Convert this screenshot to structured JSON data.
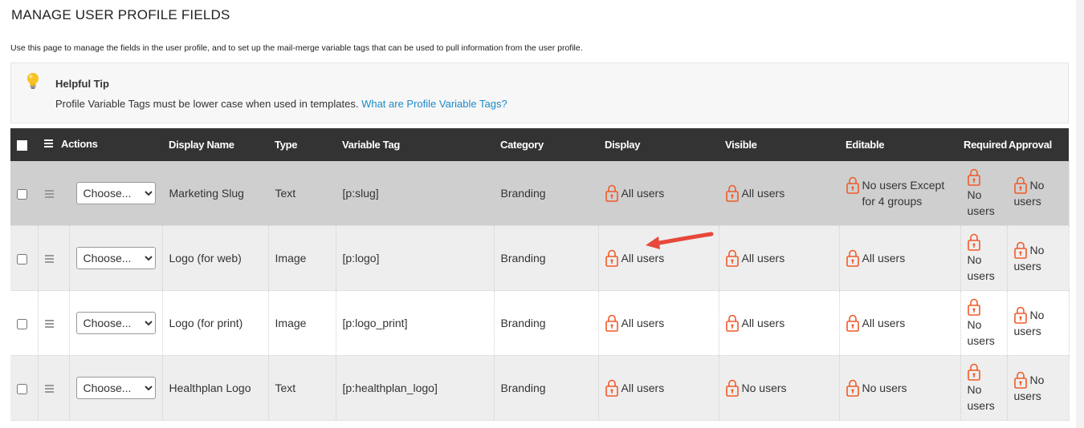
{
  "page": {
    "title": "MANAGE USER PROFILE FIELDS",
    "intro": "Use this page to manage the fields in the user profile, and to set up the mail-merge variable tags that can be used to pull information from the user profile."
  },
  "tip": {
    "title": "Helpful Tip",
    "text": "Profile Variable Tags must be lower case when used in templates.",
    "link": "What are Profile Variable Tags?",
    "icon": "lightbulb-icon"
  },
  "table": {
    "headers": {
      "actions": "Actions",
      "display_name": "Display Name",
      "type": "Type",
      "variable_tag": "Variable Tag",
      "category": "Category",
      "display": "Display",
      "visible": "Visible",
      "editable": "Editable",
      "required": "Required",
      "approval": "Approval"
    },
    "select_placeholder": "Choose...",
    "lock_color": "#f05a28",
    "rows": [
      {
        "display_name": "Marketing Slug",
        "type": "Text",
        "variable_tag": "[p:slug]",
        "category": "Branding",
        "display": "All users",
        "visible": "All users",
        "editable_1": "No users Except",
        "editable_2": "for 4 groups",
        "required_1": "No",
        "required_2": "users",
        "approval_1": "No",
        "approval_2": "users"
      },
      {
        "display_name": "Logo (for web)",
        "type": "Image",
        "variable_tag": "[p:logo]",
        "category": "Branding",
        "display": "All users",
        "visible": "All users",
        "editable_1": "All users",
        "editable_2": "",
        "required_1": "No",
        "required_2": "users",
        "approval_1": "No",
        "approval_2": "users"
      },
      {
        "display_name": "Logo (for print)",
        "type": "Image",
        "variable_tag": "[p:logo_print]",
        "category": "Branding",
        "display": "All users",
        "visible": "All users",
        "editable_1": "All users",
        "editable_2": "",
        "required_1": "No",
        "required_2": "users",
        "approval_1": "No",
        "approval_2": "users"
      },
      {
        "display_name": "Healthplan Logo",
        "type": "Text",
        "variable_tag": "[p:healthplan_logo]",
        "category": "Branding",
        "display": "All users",
        "visible": "No users",
        "editable_1": "No users",
        "editable_2": "",
        "required_1": "No",
        "required_2": "users",
        "approval_1": "No",
        "approval_2": "users"
      }
    ]
  },
  "annotation": {
    "color": "#e8473b",
    "icon": "red-arrow-annotation"
  }
}
